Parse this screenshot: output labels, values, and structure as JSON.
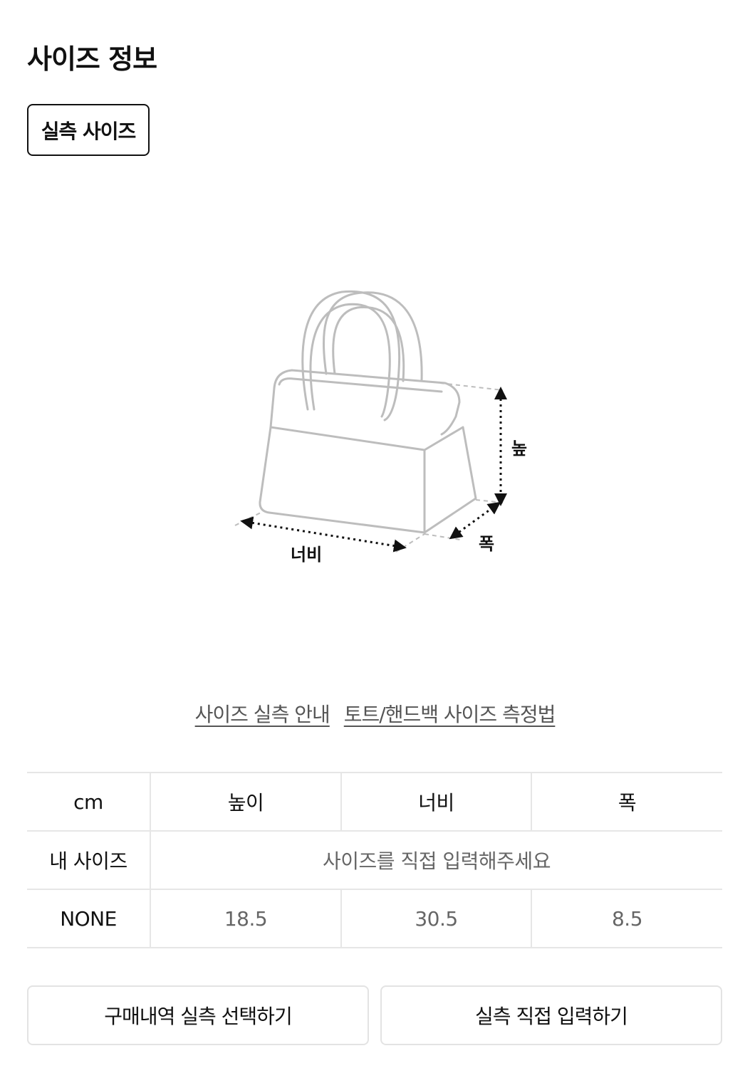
{
  "page": {
    "title": "사이즈 정보"
  },
  "tabs": [
    {
      "label": "실측 사이즈",
      "active": true
    }
  ],
  "diagram": {
    "labels": {
      "height": "높이",
      "width": "너비",
      "depth": "폭"
    }
  },
  "links": [
    {
      "label": "사이즈 실측 안내"
    },
    {
      "label": "토트/핸드백 사이즈 측정법"
    }
  ],
  "table": {
    "headers": [
      "cm",
      "높이",
      "너비",
      "폭"
    ],
    "my_size": {
      "label": "내 사이즈",
      "placeholder": "사이즈를 직접 입력해주세요"
    },
    "rows": [
      {
        "label": "NONE",
        "values": [
          "18.5",
          "30.5",
          "8.5"
        ]
      }
    ]
  },
  "buttons": {
    "left": "구매내역 실측 선택하기",
    "right": "실측 직접 입력하기"
  }
}
